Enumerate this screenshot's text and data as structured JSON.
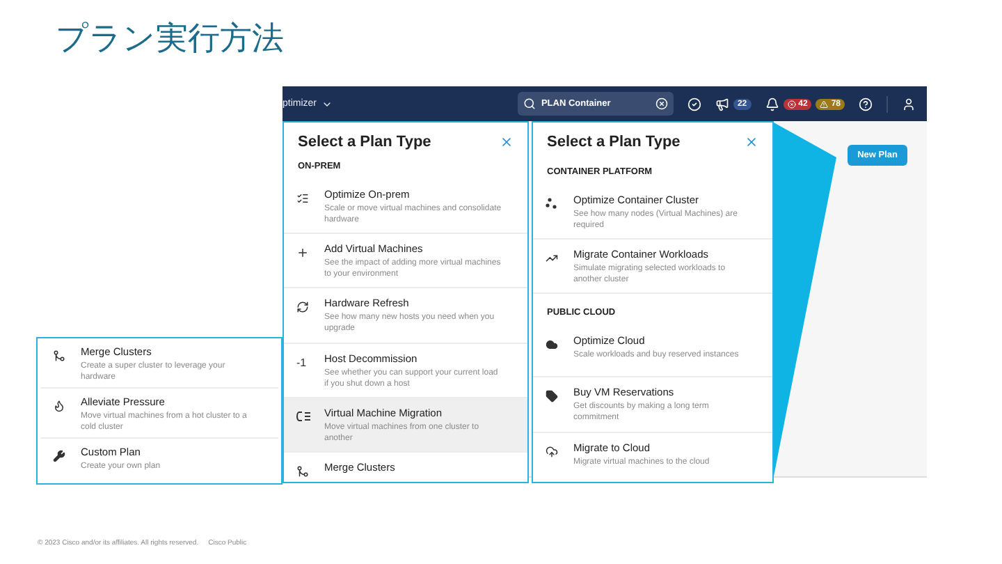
{
  "slide_title": "プラン実行方法",
  "navbar": {
    "product": "ptimizer",
    "search": {
      "value": "PLAN Container"
    },
    "announcements_count": "22",
    "alerts": [
      {
        "kind": "critical",
        "count": "42"
      },
      {
        "kind": "major",
        "count": "78"
      }
    ]
  },
  "panels": [
    {
      "title": "Select a Plan Type",
      "sections": [
        {
          "heading": "ON-PREM",
          "items": [
            {
              "title": "Optimize On-prem",
              "description": "Scale or move virtual machines and consolidate hardware",
              "selected": false
            },
            {
              "title": "Add Virtual Machines",
              "description": "See the impact of adding more virtual machines to your environment",
              "selected": false
            },
            {
              "title": "Hardware Refresh",
              "description": "See how many new hosts you need when you upgrade",
              "selected": false
            },
            {
              "title": "Host Decommission",
              "description": "See whether you can support your current load if you shut down a host",
              "glyph": "-1",
              "selected": false
            },
            {
              "title": "Virtual Machine Migration",
              "description": "Move virtual machines from one cluster to another",
              "selected": true
            },
            {
              "title": "Merge Clusters",
              "selected": false
            }
          ]
        }
      ]
    },
    {
      "title": "Select a Plan Type",
      "sections": [
        {
          "heading": "CONTAINER PLATFORM",
          "items": [
            {
              "title": "Optimize Container Cluster",
              "description": "See how many nodes (Virtual Machines) are required",
              "selected": false
            },
            {
              "title": "Migrate Container Workloads",
              "description": "Simulate migrating selected workloads to another cluster",
              "selected": false
            }
          ]
        },
        {
          "heading": "PUBLIC CLOUD",
          "items": [
            {
              "title": "Optimize Cloud",
              "description": "Scale workloads and buy reserved instances",
              "selected": false
            },
            {
              "title": "Buy VM Reservations",
              "description": "Get discounts by making a long term commitment",
              "selected": false
            },
            {
              "title": "Migrate to Cloud",
              "description": "Migrate virtual machines to the cloud",
              "selected": false
            }
          ]
        }
      ]
    }
  ],
  "new_plan_button": "New Plan",
  "callout_items": [
    {
      "title": "Merge Clusters",
      "description": "Create a super cluster to leverage your hardware",
      "selected": false
    },
    {
      "title": "Alleviate Pressure",
      "description": "Move virtual machines from a hot cluster to a cold cluster",
      "selected": false
    },
    {
      "title": "Custom Plan",
      "description": "Create your own plan",
      "selected": false
    }
  ],
  "footer": {
    "copyright": "© 2023  Cisco and/or its affiliates. All rights reserved.",
    "classification": "Cisco Public"
  }
}
